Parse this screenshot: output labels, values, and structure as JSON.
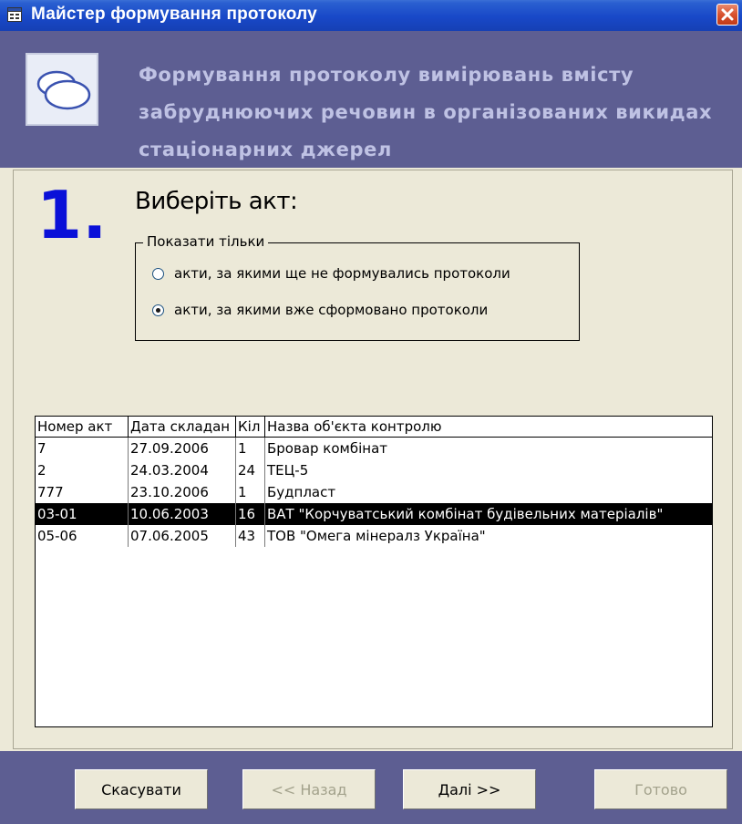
{
  "window": {
    "title": "Майстер формування протоколу"
  },
  "banner": {
    "heading": "Формування протоколу вимірювань вмісту забруднюючих речовин в організованих викидах стаціонарних джерел"
  },
  "step": {
    "number": "1.",
    "label": "Виберіть акт:"
  },
  "filter": {
    "legend": "Показати тільки",
    "options": [
      {
        "label": "акти, за якими ще не формувались протоколи",
        "selected": false
      },
      {
        "label": "акти, за якими вже сформовано протоколи",
        "selected": true
      }
    ]
  },
  "table": {
    "columns": [
      "Номер акт",
      "Дата складан",
      "Кіл",
      "Назва об'єкта контролю"
    ],
    "rows": [
      [
        "7",
        "27.09.2006",
        "1",
        "Бровар комбінат"
      ],
      [
        "2",
        "24.03.2004",
        "24",
        "ТЕЦ-5"
      ],
      [
        "777",
        "23.10.2006",
        "1",
        "Будпласт"
      ],
      [
        "03-01",
        "10.06.2003",
        "16",
        "ВАТ \"Корчуватський комбінат будівельних матеріалів\""
      ],
      [
        "05-06",
        "07.06.2005",
        "43",
        "ТОВ \"Омега мінералз Україна\""
      ]
    ],
    "selected_row": 3
  },
  "buttons": {
    "cancel": "Скасувати",
    "back": "<< Назад",
    "next": "Далі >>",
    "finish": "Готово"
  },
  "colors": {
    "banner": "#5d5e92",
    "step_number": "#0a10d8",
    "titlebar": "#1848c8"
  }
}
